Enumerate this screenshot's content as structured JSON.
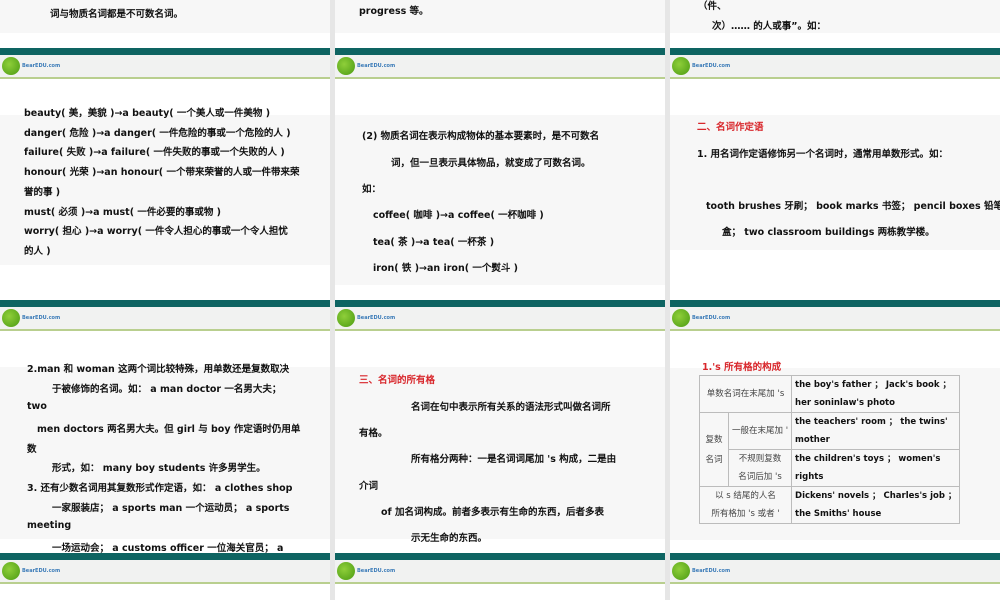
{
  "logo_text": "BearEDU.com",
  "col1": {
    "top_line": "词与物质名词都是不可数名词。",
    "slide2": [
      "beauty( 美，美貌 )→a beauty( 一个美人或一件美物 )",
      "danger( 危险 )→a danger( 一件危险的事或一个危险的人 )",
      "failure( 失败 )→a failure( 一件失败的事或一个失败的人 )",
      "honour( 光荣 )→an honour( 一个带来荣誉的人或一件带来荣",
      "誉的事 )",
      "must( 必须 )→a must( 一件必要的事或物 )",
      "worry( 担心 )→a worry( 一件令人担心的事或一个令人担忧",
      "的人 )"
    ],
    "slide3": [
      "2.man 和 woman 这两个词比较特殊，用单数还是复数取决",
      "于被修饰的名词。如： a man doctor 一名男大夫；",
      "two",
      "men doctors  两名男大夫。但 girl 与 boy 作定语时仍用单",
      "数",
      "形式，如： many boy students 许多男学生。",
      "3. 还有少数名词用其复数形式作定语，如： a clothes shop",
      "一家服装店； a sports man 一个运动员； a sports",
      "meeting",
      "一场运动会； a customs officer 一位海关官员； a"
    ]
  },
  "col2": {
    "top_line": "progress 等。",
    "slide2": [
      "(2) 物质名词在表示构成物体的基本要素时，是不可数名",
      "词，但一旦表示具体物品，就变成了可数名词。",
      "如：",
      "coffee( 咖啡 )→a coffee( 一杯咖啡 )",
      "tea( 茶 )→a tea( 一杯茶 )",
      "iron( 铁 )→an iron( 一个熨斗 )"
    ],
    "slide3": {
      "heading": "三、名词的所有格",
      "lines": [
        "名词在句中表示所有关系的语法形式叫做名词所",
        "有格。",
        "所有格分两种：一是名词词尾加 's 构成，二是由",
        "介词",
        "of 加名词构成。前者多表示有生命的东西，后者多表",
        "示无生命的东西。"
      ]
    }
  },
  "col3": {
    "top_lines": [
      "（件、",
      "次）…… 的人或事”。如："
    ],
    "slide2": {
      "heading": "二、名词作定语",
      "lines": [
        "1. 用名词作定语修饰另一个名词时，通常用单数形式。如：",
        "tooth brushes 牙刷； book marks 书签； pencil boxes 铅笔",
        "盒； two classroom buildings 两栋教学楼。"
      ]
    },
    "slide3": {
      "heading": "1.'s 所有格的构成",
      "table": {
        "r1": {
          "label": "单数名词在末尾加 's",
          "ex1": "the boy's father ；  Jack's book ；",
          "ex2": "her soninlaw's photo"
        },
        "group": "复数名词",
        "r2": {
          "label": "一般在末尾加 '",
          "ex1": "the teachers' room ；  the twins'",
          "ex2": "mother"
        },
        "r3": {
          "label1": "不规则复数",
          "label2": "名词后加 's",
          "ex1": "the children's toys ；  women's",
          "ex2": "rights"
        },
        "r4": {
          "label1": "以 s 结尾的人名",
          "label2": "所有格加 's 或者 '",
          "ex1": "Dickens' novels ；  Charles's job ；",
          "ex2": "the Smiths' house"
        }
      }
    }
  }
}
